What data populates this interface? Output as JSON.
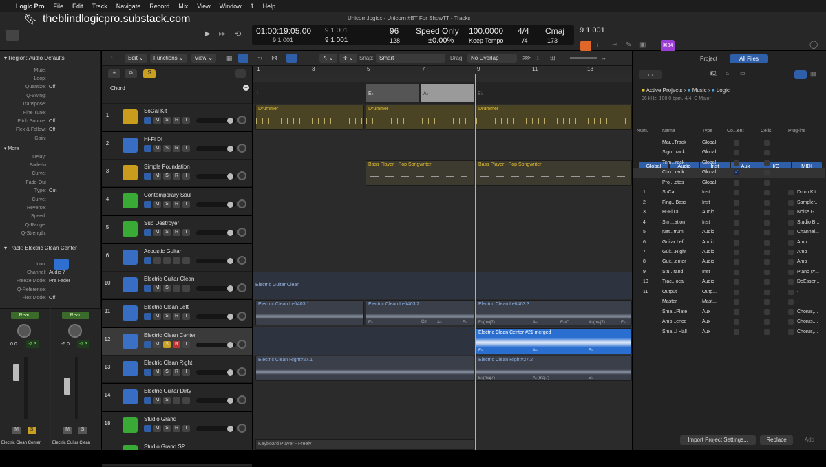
{
  "menubar": {
    "apple": "",
    "items": [
      "Logic Pro",
      "File",
      "Edit",
      "Track",
      "Navigate",
      "Record",
      "Mix",
      "View",
      "Window",
      "1",
      "Help"
    ]
  },
  "window": {
    "title": "Unicorn.logicx - Unicorn #BT For ShowTT - Tracks",
    "watermark": "theblindlogicpro.substack.com"
  },
  "lcd": {
    "time": "01:00:19:05.00",
    "time_sub": "9  1  001",
    "bars": "9  1  001",
    "bars_sub": "9  1  001",
    "tempo": "96",
    "tempo_sub": "128",
    "speed": "Speed Only",
    "speed_sub": "±0.00%",
    "rate": "100.0000",
    "rate_sub": "Keep Tempo",
    "sig": "4/4",
    "sig_sub": "/4",
    "key": "Cmaj",
    "key_sub": "173"
  },
  "badge": "⌘34",
  "inspector": {
    "region_title": "Region: Audio Defaults",
    "region_rows": [
      {
        "k": "Mute:",
        "v": ""
      },
      {
        "k": "Loop:",
        "v": ""
      },
      {
        "k": "Quantize:",
        "v": "Off"
      },
      {
        "k": "Q-Swing:",
        "v": ""
      },
      {
        "k": "Transpose:",
        "v": ""
      },
      {
        "k": "Fine Tune:",
        "v": ""
      },
      {
        "k": "Pitch Source:",
        "v": "Off"
      },
      {
        "k": "Flex & Follow:",
        "v": "Off"
      },
      {
        "k": "Gain:",
        "v": ""
      }
    ],
    "more_label": "More",
    "more_rows": [
      {
        "k": "Delay:",
        "v": ""
      },
      {
        "k": "Fade-In",
        "v": ""
      },
      {
        "k": "Curve:",
        "v": ""
      },
      {
        "k": "Fade-Out",
        "v": ""
      },
      {
        "k": "Type:",
        "v": "Out"
      },
      {
        "k": "Curve:",
        "v": ""
      },
      {
        "k": "Reverse:",
        "v": ""
      },
      {
        "k": "Speed:",
        "v": ""
      },
      {
        "k": "Q-Range:",
        "v": ""
      },
      {
        "k": "Q-Strength:",
        "v": ""
      }
    ],
    "track_title": "Track:  Electric Clean Center",
    "track_rows": [
      {
        "k": "Icon:",
        "v": ""
      },
      {
        "k": "Channel:",
        "v": "Audio 7"
      },
      {
        "k": "Freeze Mode:",
        "v": "Pre Fader"
      },
      {
        "k": "Q-Reference:",
        "v": ""
      },
      {
        "k": "Flex Mode:",
        "v": "Off"
      }
    ],
    "strip1": {
      "read": "Read",
      "v1": "0.0",
      "v2": "-2.3",
      "name": "Electric Clean Center"
    },
    "strip2": {
      "read": "Read",
      "v1": "-5.0",
      "v2": "-7.3",
      "name": "Electric Guitar Clean"
    }
  },
  "edit_bar": {
    "edit": "Edit",
    "functions": "Functions",
    "view": "View",
    "snap_label": "Snap:",
    "snap": "Smart",
    "drag_label": "Drag:",
    "drag": "No Overlap"
  },
  "chord_label": "Chord",
  "ruler": [
    "1",
    "3",
    "5",
    "7",
    "9",
    "11",
    "13"
  ],
  "tracks": [
    {
      "num": "1",
      "name": "SoCal Kit",
      "color": "#e8b21c",
      "m": "M",
      "s": "S",
      "r": "R",
      "i": "I"
    },
    {
      "num": "2",
      "name": "Hi-Fi DI",
      "color": "#3b7be0",
      "m": "M",
      "s": "S",
      "r": "R",
      "i": "I"
    },
    {
      "num": "3",
      "name": "Simple Foundation",
      "color": "#e8b21c",
      "m": "M",
      "s": "S",
      "r": "R",
      "i": "I"
    },
    {
      "num": "4",
      "name": "Contemporary Soul",
      "color": "#3ec23a",
      "m": "M",
      "s": "S",
      "r": "R",
      "i": "I"
    },
    {
      "num": "5",
      "name": "Sub Destroyer",
      "color": "#3ec23a",
      "m": "M",
      "s": "S",
      "r": "R",
      "i": "I"
    },
    {
      "num": "6",
      "name": "Acoustic Guitar",
      "color": "#3b7be0",
      "m": "",
      "s": "",
      "r": "",
      "i": ""
    },
    {
      "num": "10",
      "name": "Electric Guitar Clean",
      "color": "#3b7be0",
      "m": "M",
      "s": "S",
      "r": "",
      "i": ""
    },
    {
      "num": "11",
      "name": "Electric Clean Left",
      "color": "#3b7be0",
      "m": "M",
      "s": "S",
      "r": "R",
      "i": "I"
    },
    {
      "num": "12",
      "name": "Electric Clean Center",
      "color": "#3b7be0",
      "m": "M",
      "s": "S",
      "r": "R",
      "i": "I"
    },
    {
      "num": "13",
      "name": "Electric Clean Right",
      "color": "#3b7be0",
      "m": "M",
      "s": "S",
      "r": "R",
      "i": "I"
    },
    {
      "num": "14",
      "name": "Electric Guitar Dirty",
      "color": "#3b7be0",
      "m": "M",
      "s": "S",
      "r": "",
      "i": ""
    },
    {
      "num": "18",
      "name": "Studio Grand",
      "color": "#3ec23a",
      "m": "M",
      "s": "S",
      "r": "R",
      "i": "I"
    },
    {
      "num": "",
      "name": "Studio Grand SP",
      "color": "#3ec23a",
      "m": "",
      "s": "",
      "r": "",
      "i": ""
    }
  ],
  "regions": {
    "chord_markers": [
      "C",
      "E♭",
      "A♭",
      "E♭"
    ],
    "drummer": "Drummer",
    "bass": "Bass Player - Pop Songwriter",
    "egc": "Electric Guitar Clean",
    "left1": "Electric Clean Left#03.1",
    "left2": "Electric Clean Left#03.2",
    "left3": "Electric Clean Left#03.3",
    "center": "Electric Clean Center #21 merged",
    "right1": "Electric Clean Right#27.1",
    "right2": "Electric Clean Right#27.2",
    "keys": "Keyboard Player - Freely",
    "chords_a": [
      "E♭",
      "Cm",
      "A♭",
      "E♭"
    ],
    "chords_b": [
      "E♭(maj7)",
      "A♭",
      "E♭/C",
      "A♭(maj7)",
      "E♭"
    ]
  },
  "browser": {
    "tab_project": "Project",
    "tab_all": "All Files",
    "path": [
      "Active Projects",
      "Music",
      "Logic"
    ],
    "info": "96 kHz, 100.0 bpm, 4/4, C Major",
    "filters": [
      "Global",
      "Audio",
      "Inst",
      "Aux",
      "I/O",
      "MIDI"
    ],
    "columns": [
      "Num.",
      "Name",
      "Type",
      "Co...ent",
      "Cells",
      "Plug-ins"
    ],
    "rows": [
      {
        "num": "",
        "name": "Mar...Track",
        "type": "Global",
        "chk": false,
        "plug": ""
      },
      {
        "num": "",
        "name": "Sign...rack",
        "type": "Global",
        "chk": false,
        "plug": ""
      },
      {
        "num": "",
        "name": "Tem...rack",
        "type": "Global",
        "chk": false,
        "plug": ""
      },
      {
        "num": "",
        "name": "Cho...rack",
        "type": "Global",
        "chk": true,
        "plug": ""
      },
      {
        "num": "",
        "name": "Proj...otes",
        "type": "Global",
        "chk": false,
        "plug": ""
      },
      {
        "num": "1",
        "name": "SoCal",
        "type": "Inst",
        "chk": false,
        "plug": "Drum Kit..."
      },
      {
        "num": "2",
        "name": "Fing...Bass",
        "type": "Inst",
        "chk": false,
        "plug": "Sampler..."
      },
      {
        "num": "3",
        "name": "Hi-Fi DI",
        "type": "Audio",
        "chk": false,
        "plug": "Noise G..."
      },
      {
        "num": "4",
        "name": "Sim...ation",
        "type": "Inst",
        "chk": false,
        "plug": "Studio B..."
      },
      {
        "num": "5",
        "name": "Nat...trum",
        "type": "Audio",
        "chk": false,
        "plug": "Channel..."
      },
      {
        "num": "6",
        "name": "Guitar Left",
        "type": "Audio",
        "chk": false,
        "plug": "Amp"
      },
      {
        "num": "7",
        "name": "Guit...Right",
        "type": "Audio",
        "chk": false,
        "plug": "Amp"
      },
      {
        "num": "8",
        "name": "Guit...enter",
        "type": "Audio",
        "chk": false,
        "plug": "Amp"
      },
      {
        "num": "9",
        "name": "Stu...rand",
        "type": "Inst",
        "chk": false,
        "plug": "Piano (#..."
      },
      {
        "num": "10",
        "name": "Trac...ocal",
        "type": "Audio",
        "chk": false,
        "plug": "DeEsser..."
      },
      {
        "num": "11",
        "name": "Output",
        "type": "Outp...",
        "chk": false,
        "plug": "-"
      },
      {
        "num": "",
        "name": "Master",
        "type": "Mast...",
        "chk": false,
        "plug": "-"
      },
      {
        "num": "",
        "name": "Sma...Plate",
        "type": "Aux",
        "chk": false,
        "plug": "Chorus,..."
      },
      {
        "num": "",
        "name": "Amb...ence",
        "type": "Aux",
        "chk": false,
        "plug": "Chorus,..."
      },
      {
        "num": "",
        "name": "Sma...l Hall",
        "type": "Aux",
        "chk": false,
        "plug": "Chorus,..."
      }
    ],
    "import_btn": "Import Project Settings...",
    "replace_btn": "Replace",
    "add_btn": "Add"
  }
}
